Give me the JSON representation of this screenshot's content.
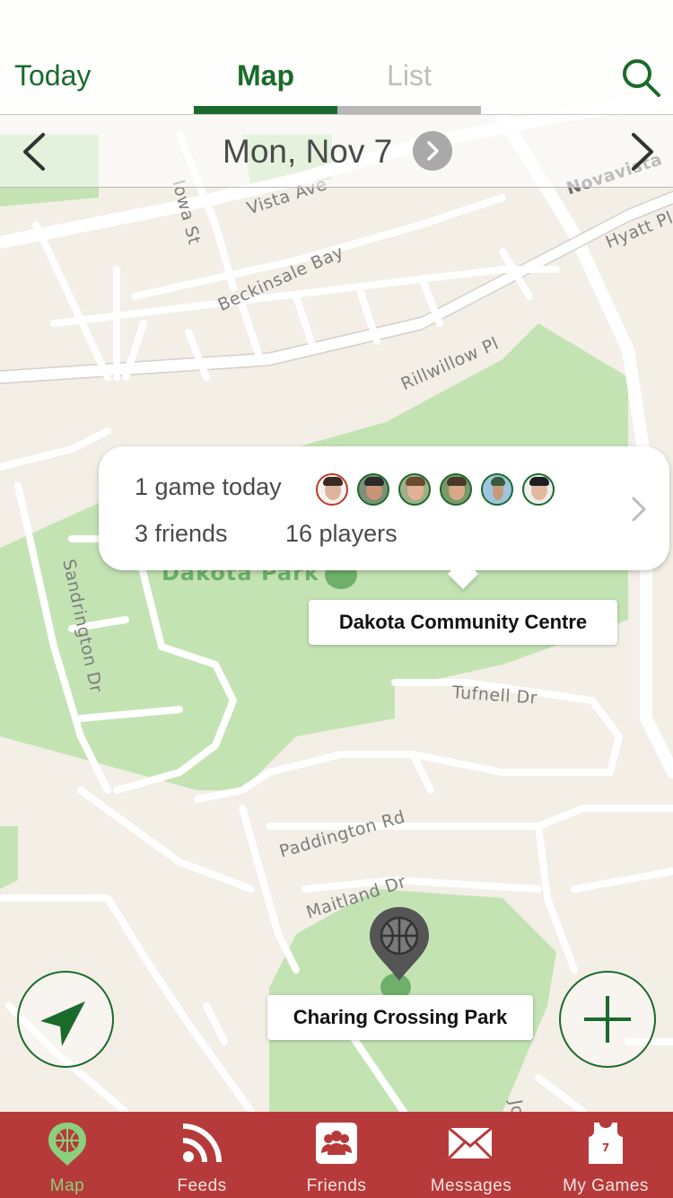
{
  "header": {
    "today_label": "Today",
    "tabs": [
      {
        "label": "Map",
        "active": true
      },
      {
        "label": "List",
        "active": false
      }
    ],
    "search_icon": "search-icon"
  },
  "date_bar": {
    "date": "Mon, Nov 7"
  },
  "map": {
    "streets": [
      "Iowa St",
      "Vista Ave",
      "Novavista",
      "Hyatt Pl",
      "Beckinsale Bay",
      "Rillwillow Pl",
      "Sandrington Dr",
      "Tufnell Dr",
      "Paddington Rd",
      "Maitland Dr",
      "Jo"
    ],
    "parks": [
      "Dakota Park"
    ]
  },
  "callout": {
    "games": "1 game today",
    "friends": "3 friends",
    "players": "16 players",
    "avatar_count": 6
  },
  "places": {
    "dakota": "Dakota Community Centre",
    "charing": "Charing Crossing Park"
  },
  "tabbar": {
    "items": [
      {
        "label": "Map",
        "icon": "basketball-pin-icon",
        "active": true
      },
      {
        "label": "Feeds",
        "icon": "rss-icon",
        "active": false
      },
      {
        "label": "Friends",
        "icon": "friends-icon",
        "active": false
      },
      {
        "label": "Messages",
        "icon": "envelope-icon",
        "active": false
      },
      {
        "label": "My Games",
        "icon": "jersey-icon",
        "active": false
      }
    ]
  },
  "colors": {
    "accent_green": "#1a6b2b",
    "tabbar_red": "#b73a3a",
    "active_tab_label": "#8bd07c",
    "park_green": "#c4e3b3"
  }
}
